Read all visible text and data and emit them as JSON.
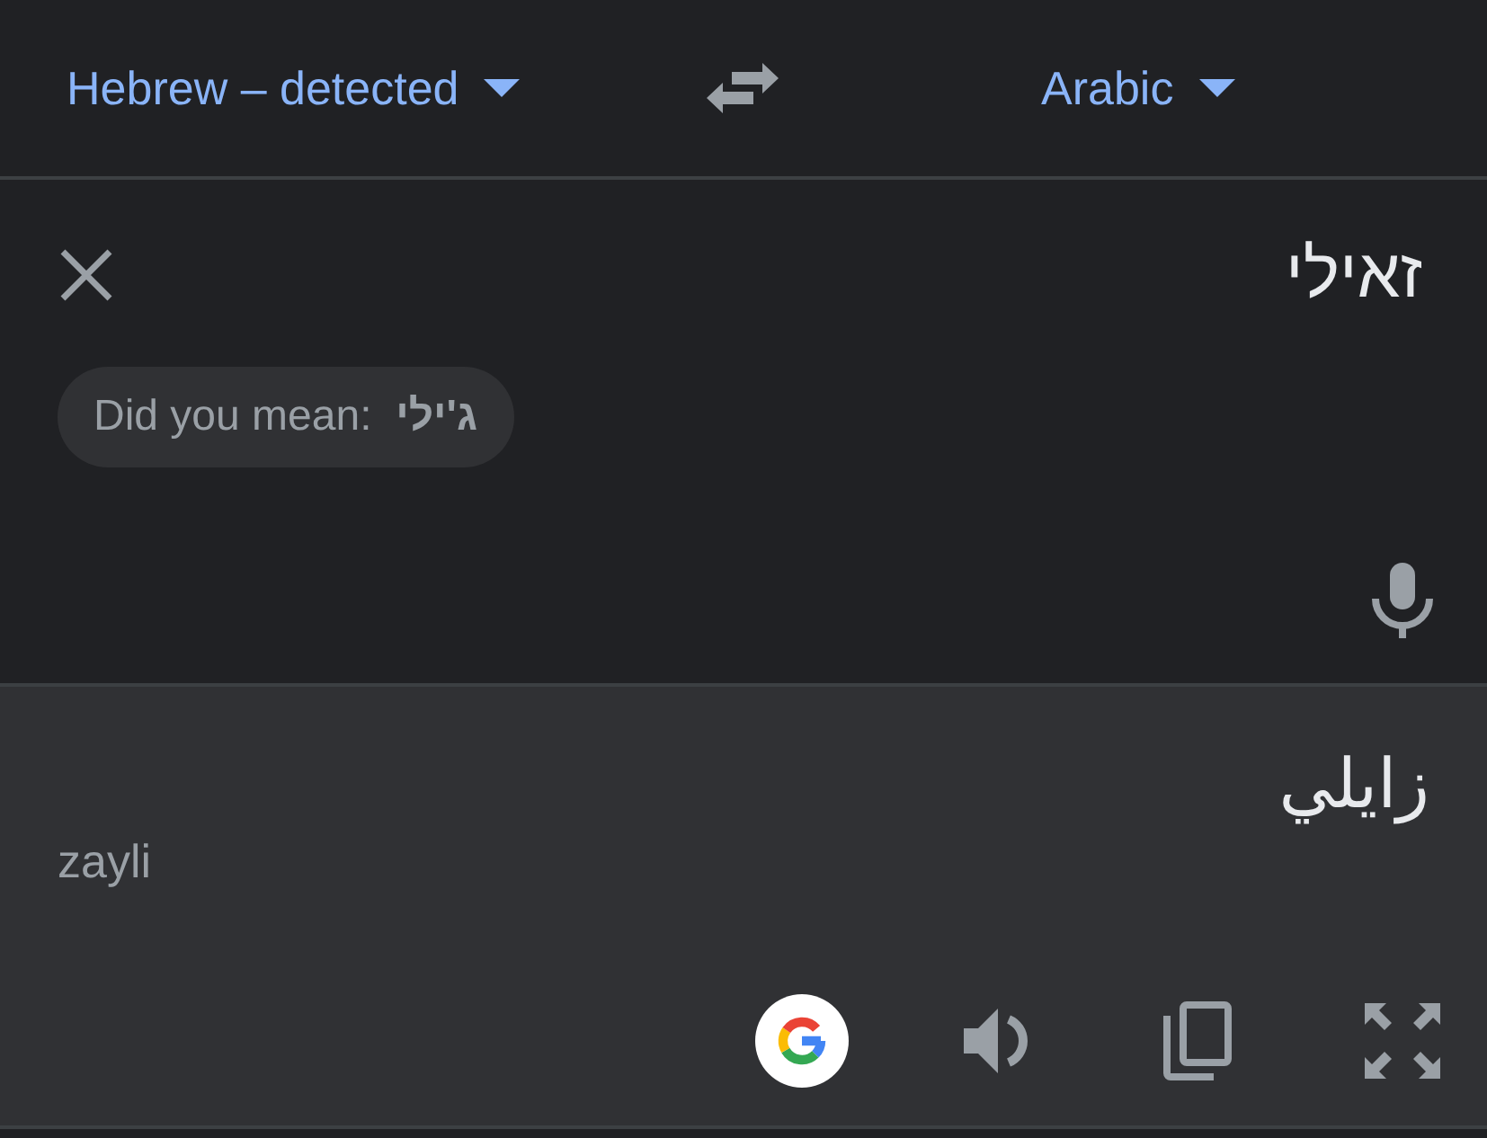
{
  "language_bar": {
    "source_language": {
      "label": "Hebrew – detected"
    },
    "target_language": {
      "label": "Arabic"
    }
  },
  "input": {
    "text": "זאילי",
    "suggestion": "Did you mean:  **ג'ילי**"
  },
  "output": {
    "text": "زايلي",
    "transliteration": "zayli"
  }
}
